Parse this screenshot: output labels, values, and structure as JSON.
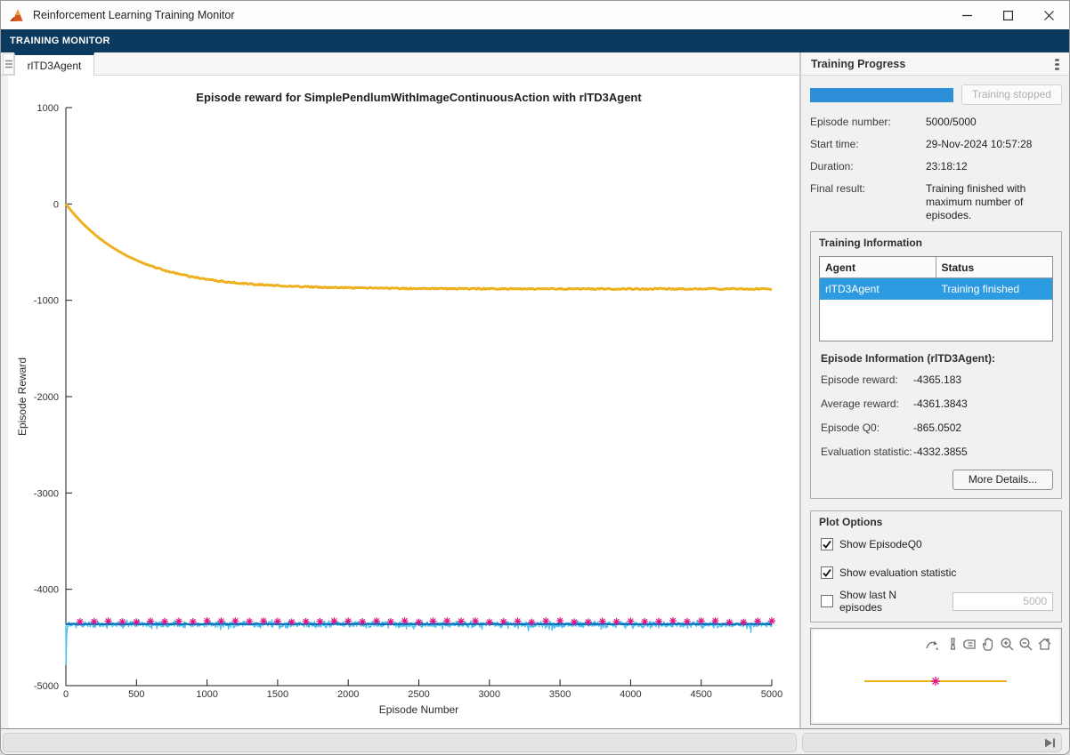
{
  "window": {
    "title": "Reinforcement Learning Training Monitor",
    "controls": [
      "minimize",
      "maximize",
      "close"
    ]
  },
  "toolstrip": {
    "tab_label": "TRAINING MONITOR"
  },
  "doc_tab": {
    "label": "rlTD3Agent"
  },
  "right_panel": {
    "header_title": "Training Progress",
    "progress": {
      "percent": 100,
      "button_label": "Training stopped"
    },
    "fields": [
      {
        "label": "Episode number:",
        "value": "5000/5000"
      },
      {
        "label": "Start time:",
        "value": "29-Nov-2024 10:57:28"
      },
      {
        "label": "Duration:",
        "value": "23:18:12"
      },
      {
        "label": "Final result:",
        "value": "Training finished with maximum number of episodes."
      }
    ],
    "training_information": {
      "title": "Training Information",
      "table": {
        "headers": [
          "Agent",
          "Status"
        ],
        "rows": [
          [
            "rlTD3Agent",
            "Training finished"
          ]
        ]
      },
      "episode_info_title": "Episode Information (rlTD3Agent):",
      "stats": [
        {
          "label": "Episode reward:",
          "value": "-4365.183"
        },
        {
          "label": "Average reward:",
          "value": "-4361.3843"
        },
        {
          "label": "Episode Q0:",
          "value": "-865.0502"
        },
        {
          "label": "Evaluation statistic:",
          "value": "-4332.3855"
        }
      ],
      "more_details_label": "More Details..."
    },
    "plot_options": {
      "title": "Plot Options",
      "checkboxes": [
        {
          "label": "Show EpisodeQ0",
          "checked": true
        },
        {
          "label": "Show evaluation statistic",
          "checked": true
        },
        {
          "label": "Show last N episodes",
          "checked": false
        }
      ],
      "n_input_value": "5000"
    },
    "mini_plot": {
      "toolbar_icons": [
        "export-icon",
        "brush-icon",
        "datatips-icon",
        "pan-icon",
        "zoom-in-icon",
        "zoom-out-icon",
        "restore-view-icon"
      ],
      "line_color": "#EDB120",
      "marker_color": "#DE1285"
    }
  },
  "colors": {
    "toolstrip_navy": "#0c3a5e",
    "progress_blue": "#2e8fd9",
    "selection_blue": "#2d9be2",
    "episode_reward_cyan": "#4DBEEE",
    "average_reward_blue": "#0072BD",
    "episode_q0_yellow": "#EDB120",
    "evaluation_magenta": "#DE1285"
  },
  "chart_data": {
    "type": "line",
    "title": "Episode reward for SimplePendlumWithImageContinuousAction with rlTD3Agent",
    "xlabel": "Episode Number",
    "ylabel": "Episode Reward",
    "xlim": [
      0,
      5000
    ],
    "ylim": [
      -5000,
      1000
    ],
    "xticks": [
      0,
      500,
      1000,
      1500,
      2000,
      2500,
      3000,
      3500,
      4000,
      4500,
      5000
    ],
    "yticks": [
      -5000,
      -4000,
      -3000,
      -2000,
      -1000,
      0,
      1000
    ],
    "grid": false,
    "legend": "none",
    "series": [
      {
        "name": "EpisodeReward",
        "type": "noisy_flat",
        "color": "#4DBEEE",
        "mean": -4365,
        "noise": 40,
        "initial_dip": [
          [
            0,
            -4360
          ],
          [
            1,
            -4690
          ],
          [
            2,
            -4780
          ],
          [
            3,
            -4610
          ],
          [
            5,
            -4500
          ],
          [
            8,
            -4430
          ]
        ]
      },
      {
        "name": "AverageReward",
        "type": "flat",
        "color": "#0072BD",
        "value": -4361,
        "jitter": 6
      },
      {
        "name": "EvaluationStatistic",
        "type": "markers",
        "color": "#DE1285",
        "value": -4334,
        "jitter": 16,
        "interval": 100,
        "marker": "asterisk"
      },
      {
        "name": "EpisodeQ0",
        "type": "decay",
        "color": "#EDB120",
        "start": 0,
        "plateau": -882,
        "tau": 460
      }
    ]
  }
}
